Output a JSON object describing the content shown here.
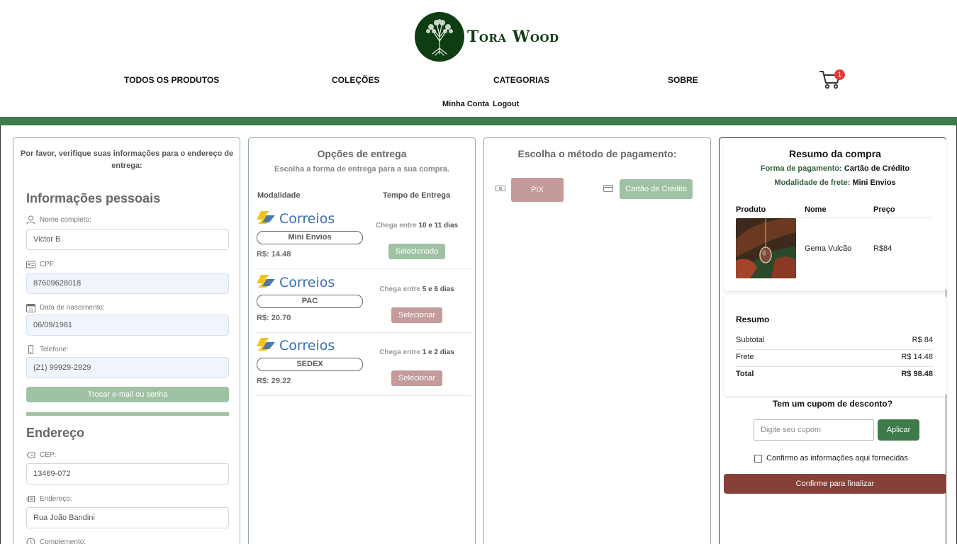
{
  "brand": {
    "name": "Tora Wood"
  },
  "nav": {
    "items": [
      "TODOS OS PRODUTOS",
      "COLEÇÕES",
      "CATEGORIAS",
      "SOBRE"
    ],
    "cart_count": "1",
    "account": "Minha Conta",
    "logout": "Logout"
  },
  "personal": {
    "heading": "Por favor, verifique suas informações para o endereço de entrega:",
    "title": "Informações pessoais",
    "name_label": "Nome completo:",
    "name_value": "Victor B",
    "cpf_label": "CPF:",
    "cpf_value": "87609628018",
    "birth_label": "Data de nascimento:",
    "birth_value": "06/09/1981",
    "phone_label": "Telefone:",
    "phone_value": "(21) 99929-2929",
    "change_button": "Trocar e-mail ou senha"
  },
  "address": {
    "title": "Endereço",
    "cep_label": "CEP:",
    "cep_value": "13469-072",
    "street_label": "Endereço:",
    "street_value": "Rua João Bandini",
    "complement_label": "Complemento:"
  },
  "shipping": {
    "title": "Opções de entrega",
    "subtitle": "Escolha a forma de entrega para a sua compra.",
    "col_modality": "Modalidade",
    "col_time": "Tempo de Entrega",
    "carrier_logo_text": "Correios",
    "options": [
      {
        "name": "Mini Envios",
        "price": "R$: 14.48",
        "time_prefix": "Chega entre",
        "time_range": "10 e 11 dias",
        "button": "Selecionado",
        "selected": true
      },
      {
        "name": "PAC",
        "price": "R$: 20.70",
        "time_prefix": "Chega entre",
        "time_range": "5 e 6 dias",
        "button": "Selecionar",
        "selected": false
      },
      {
        "name": "SEDEX",
        "price": "R$: 29.22",
        "time_prefix": "Chega entre",
        "time_range": "1 e 2 dias",
        "button": "Selecionar",
        "selected": false
      }
    ]
  },
  "payment": {
    "title": "Escolha o método de pagamento:",
    "pix": "PIX",
    "credit": "Cartão de Crédito",
    "pix_color": "#c49a9a",
    "credit_color": "#9fc2a4"
  },
  "summary": {
    "title": "Resumo da compra",
    "payment_label": "Forma de pagamento:",
    "payment_value": "Cartão de Crédito",
    "shipping_label": "Modalidade de frete:",
    "shipping_value": "Mini Envios",
    "col_product": "Produto",
    "col_name": "Nome",
    "col_price": "Preço",
    "item_name": "Gema Vulcão",
    "item_price": "R$84",
    "resumo_title": "Resumo",
    "subtotal_label": "Subtotal",
    "subtotal_value": "R$ 84",
    "shipping_fee_label": "Frete",
    "shipping_fee_value": "R$ 14.48",
    "total_label": "Total",
    "total_value": "R$ 98.48",
    "coupon_title": "Tem um cupom de desconto?",
    "coupon_placeholder": "Digite seu cupom",
    "coupon_button": "Aplicar",
    "confirm_checkbox": "Confirmo as informações aqui fornecidas",
    "finalize_button": "Confirme para finalizar"
  },
  "colors": {
    "brand_green": "#3e7b4b",
    "finalize_red": "#864038",
    "badge_red": "#e03a3a"
  }
}
